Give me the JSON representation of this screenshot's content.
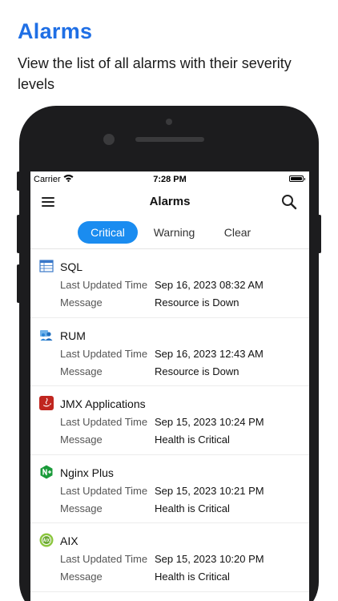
{
  "promo": {
    "title": "Alarms",
    "subtitle": "View the list of all alarms with their severity levels"
  },
  "status_bar": {
    "carrier": "Carrier",
    "time": "7:28 PM"
  },
  "nav": {
    "title": "Alarms",
    "menu_icon": "hamburger-menu-icon",
    "search_icon": "search-icon"
  },
  "tabs": [
    {
      "label": "Critical",
      "active": true
    },
    {
      "label": "Warning",
      "active": false
    },
    {
      "label": "Clear",
      "active": false
    }
  ],
  "labels": {
    "last_updated": "Last Updated Time",
    "message": "Message"
  },
  "alarms": [
    {
      "name": "SQL",
      "icon": "sql-database-icon",
      "last_updated": "Sep 16, 2023 08:32 AM",
      "message": "Resource is Down"
    },
    {
      "name": "RUM",
      "icon": "rum-users-icon",
      "last_updated": "Sep 16, 2023 12:43 AM",
      "message": "Resource is Down"
    },
    {
      "name": "JMX Applications",
      "icon": "java-icon",
      "last_updated": "Sep 15, 2023 10:24 PM",
      "message": "Health is Critical"
    },
    {
      "name": "Nginx Plus",
      "icon": "nginx-plus-icon",
      "last_updated": "Sep 15, 2023 10:21 PM",
      "message": "Health is Critical"
    },
    {
      "name": "AIX",
      "icon": "aix-icon",
      "last_updated": "Sep 15, 2023 10:20 PM",
      "message": "Health is Critical"
    }
  ],
  "colors": {
    "accent": "#1a8cf0",
    "promo_title": "#1f6fe5",
    "phone_frame": "#1c1c1e"
  }
}
